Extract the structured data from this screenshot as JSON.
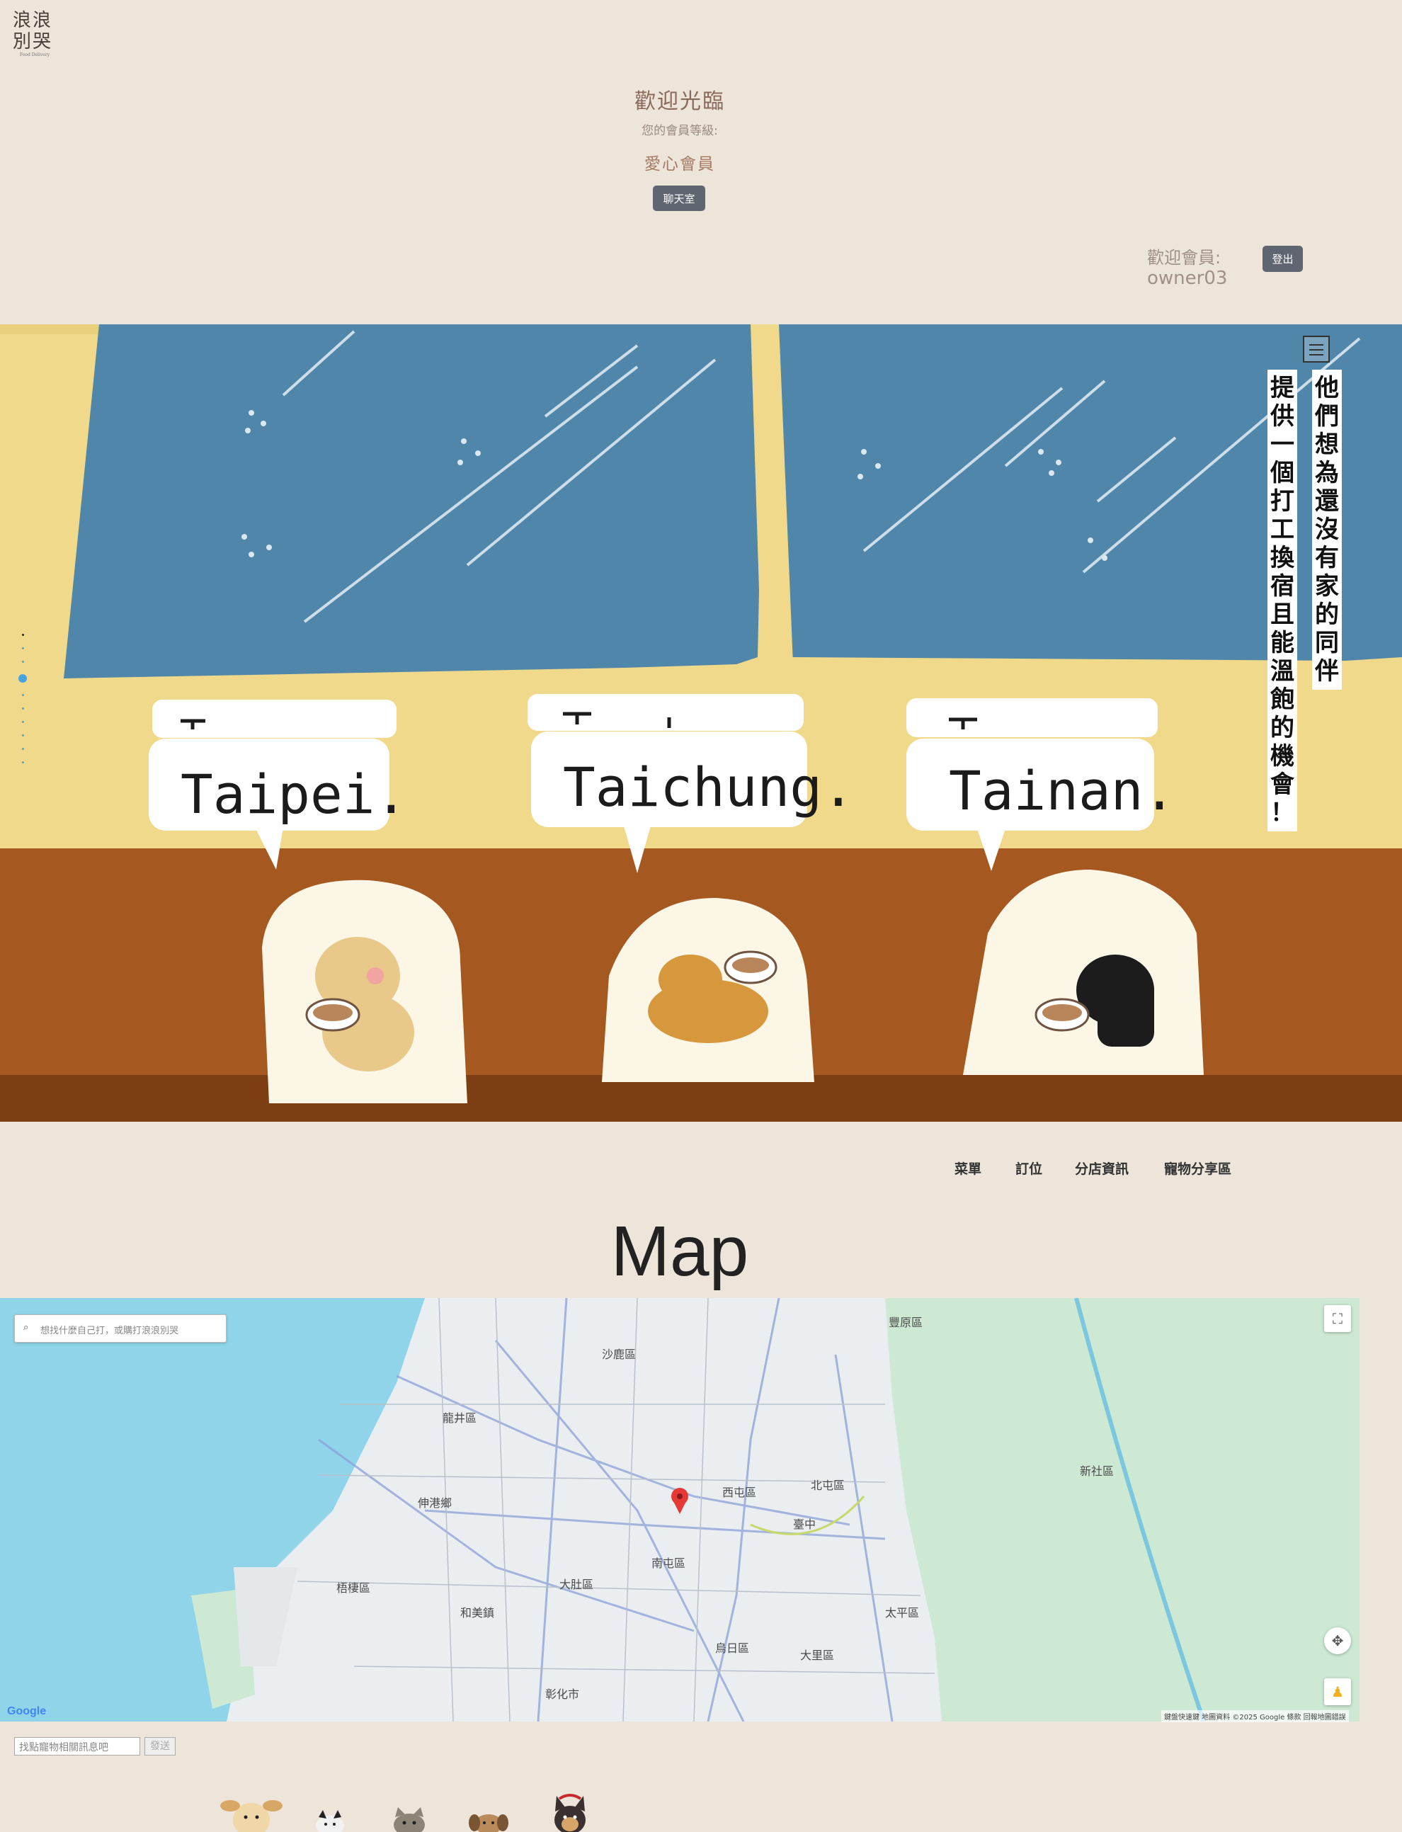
{
  "header": {
    "logo_text": "浪浪別哭",
    "logo_sub": "Food Delivery",
    "welcome": "歡迎光臨",
    "level_label": "您的會員等級:",
    "level_value": "愛心會員",
    "chat_button": "聊天室",
    "member_label": "歡迎會員:",
    "member_name": "owner03",
    "logout_button": "登出"
  },
  "hero": {
    "bubbles": [
      "Taipei.",
      "Taichung.",
      "Tainan."
    ],
    "vertical_right": "他們想為還沒有家的同伴",
    "vertical_left": "提供一個打工換宿且能溫飽的機會！",
    "slide_count": 10,
    "active_slide": 3,
    "colors": {
      "sky": "#4f86aa",
      "wall": "#f0d98a",
      "counter": "#a5581f"
    }
  },
  "nav": {
    "items": [
      "菜單",
      "訂位",
      "分店資訊",
      "寵物分享區"
    ]
  },
  "map": {
    "title": "Map",
    "search_placeholder": "想找什麼自己打，或購打浪浪別哭",
    "labels": [
      "沙鹿區",
      "龍井區",
      "西屯區",
      "北屯區",
      "南屯區",
      "大肚區",
      "和美鎮",
      "大里區",
      "太平區",
      "新社區",
      "豐原區",
      "臺中",
      "彰化市",
      "烏日區",
      "梧棲區",
      "伸港鄉"
    ],
    "google_logo": "Google",
    "attribution": "鍵盤快速鍵  地圖資料 ©2025 Google  條款  回報地圖錯誤",
    "colors": {
      "sea": "#8fd4e8",
      "land": "#eaeef0",
      "green": "#cde9d4",
      "road": "#8aa0d8"
    }
  },
  "pet_search": {
    "placeholder": "找點寵物相關訊息吧",
    "button": "發送"
  },
  "pets": [
    "dog-1",
    "dog-2",
    "cat",
    "dog-3",
    "dog-4"
  ]
}
